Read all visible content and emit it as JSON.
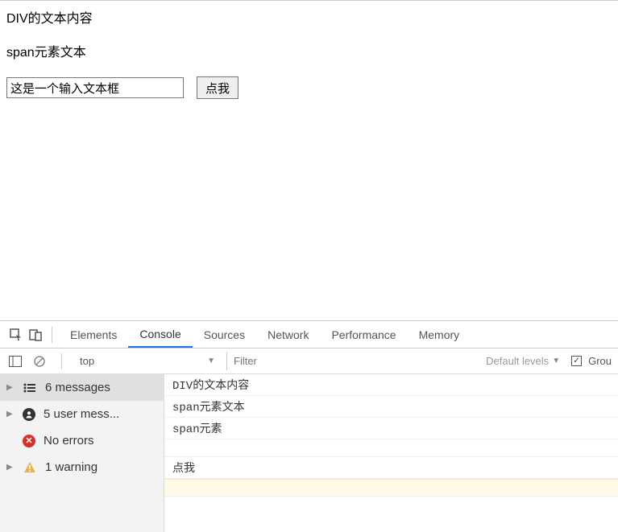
{
  "page": {
    "div_text": "DIV的文本内容",
    "span_text": "span元素文本",
    "input_value": "这是一个输入文本框",
    "button_label": "点我"
  },
  "devtools": {
    "tabs": {
      "elements": "Elements",
      "console": "Console",
      "sources": "Sources",
      "network": "Network",
      "performance": "Performance",
      "memory": "Memory"
    },
    "toolbar": {
      "context": "top",
      "filter_placeholder": "Filter",
      "default_levels": "Default levels",
      "group_label": "Grou"
    },
    "sidebar": {
      "messages": "6 messages",
      "user_messages": "5 user mess...",
      "no_errors": "No errors",
      "warning": "1 warning"
    },
    "logs": {
      "l0": "DIV的文本内容",
      "l1": "span元素文本",
      "l2": "span元素",
      "l3": "点我"
    }
  }
}
